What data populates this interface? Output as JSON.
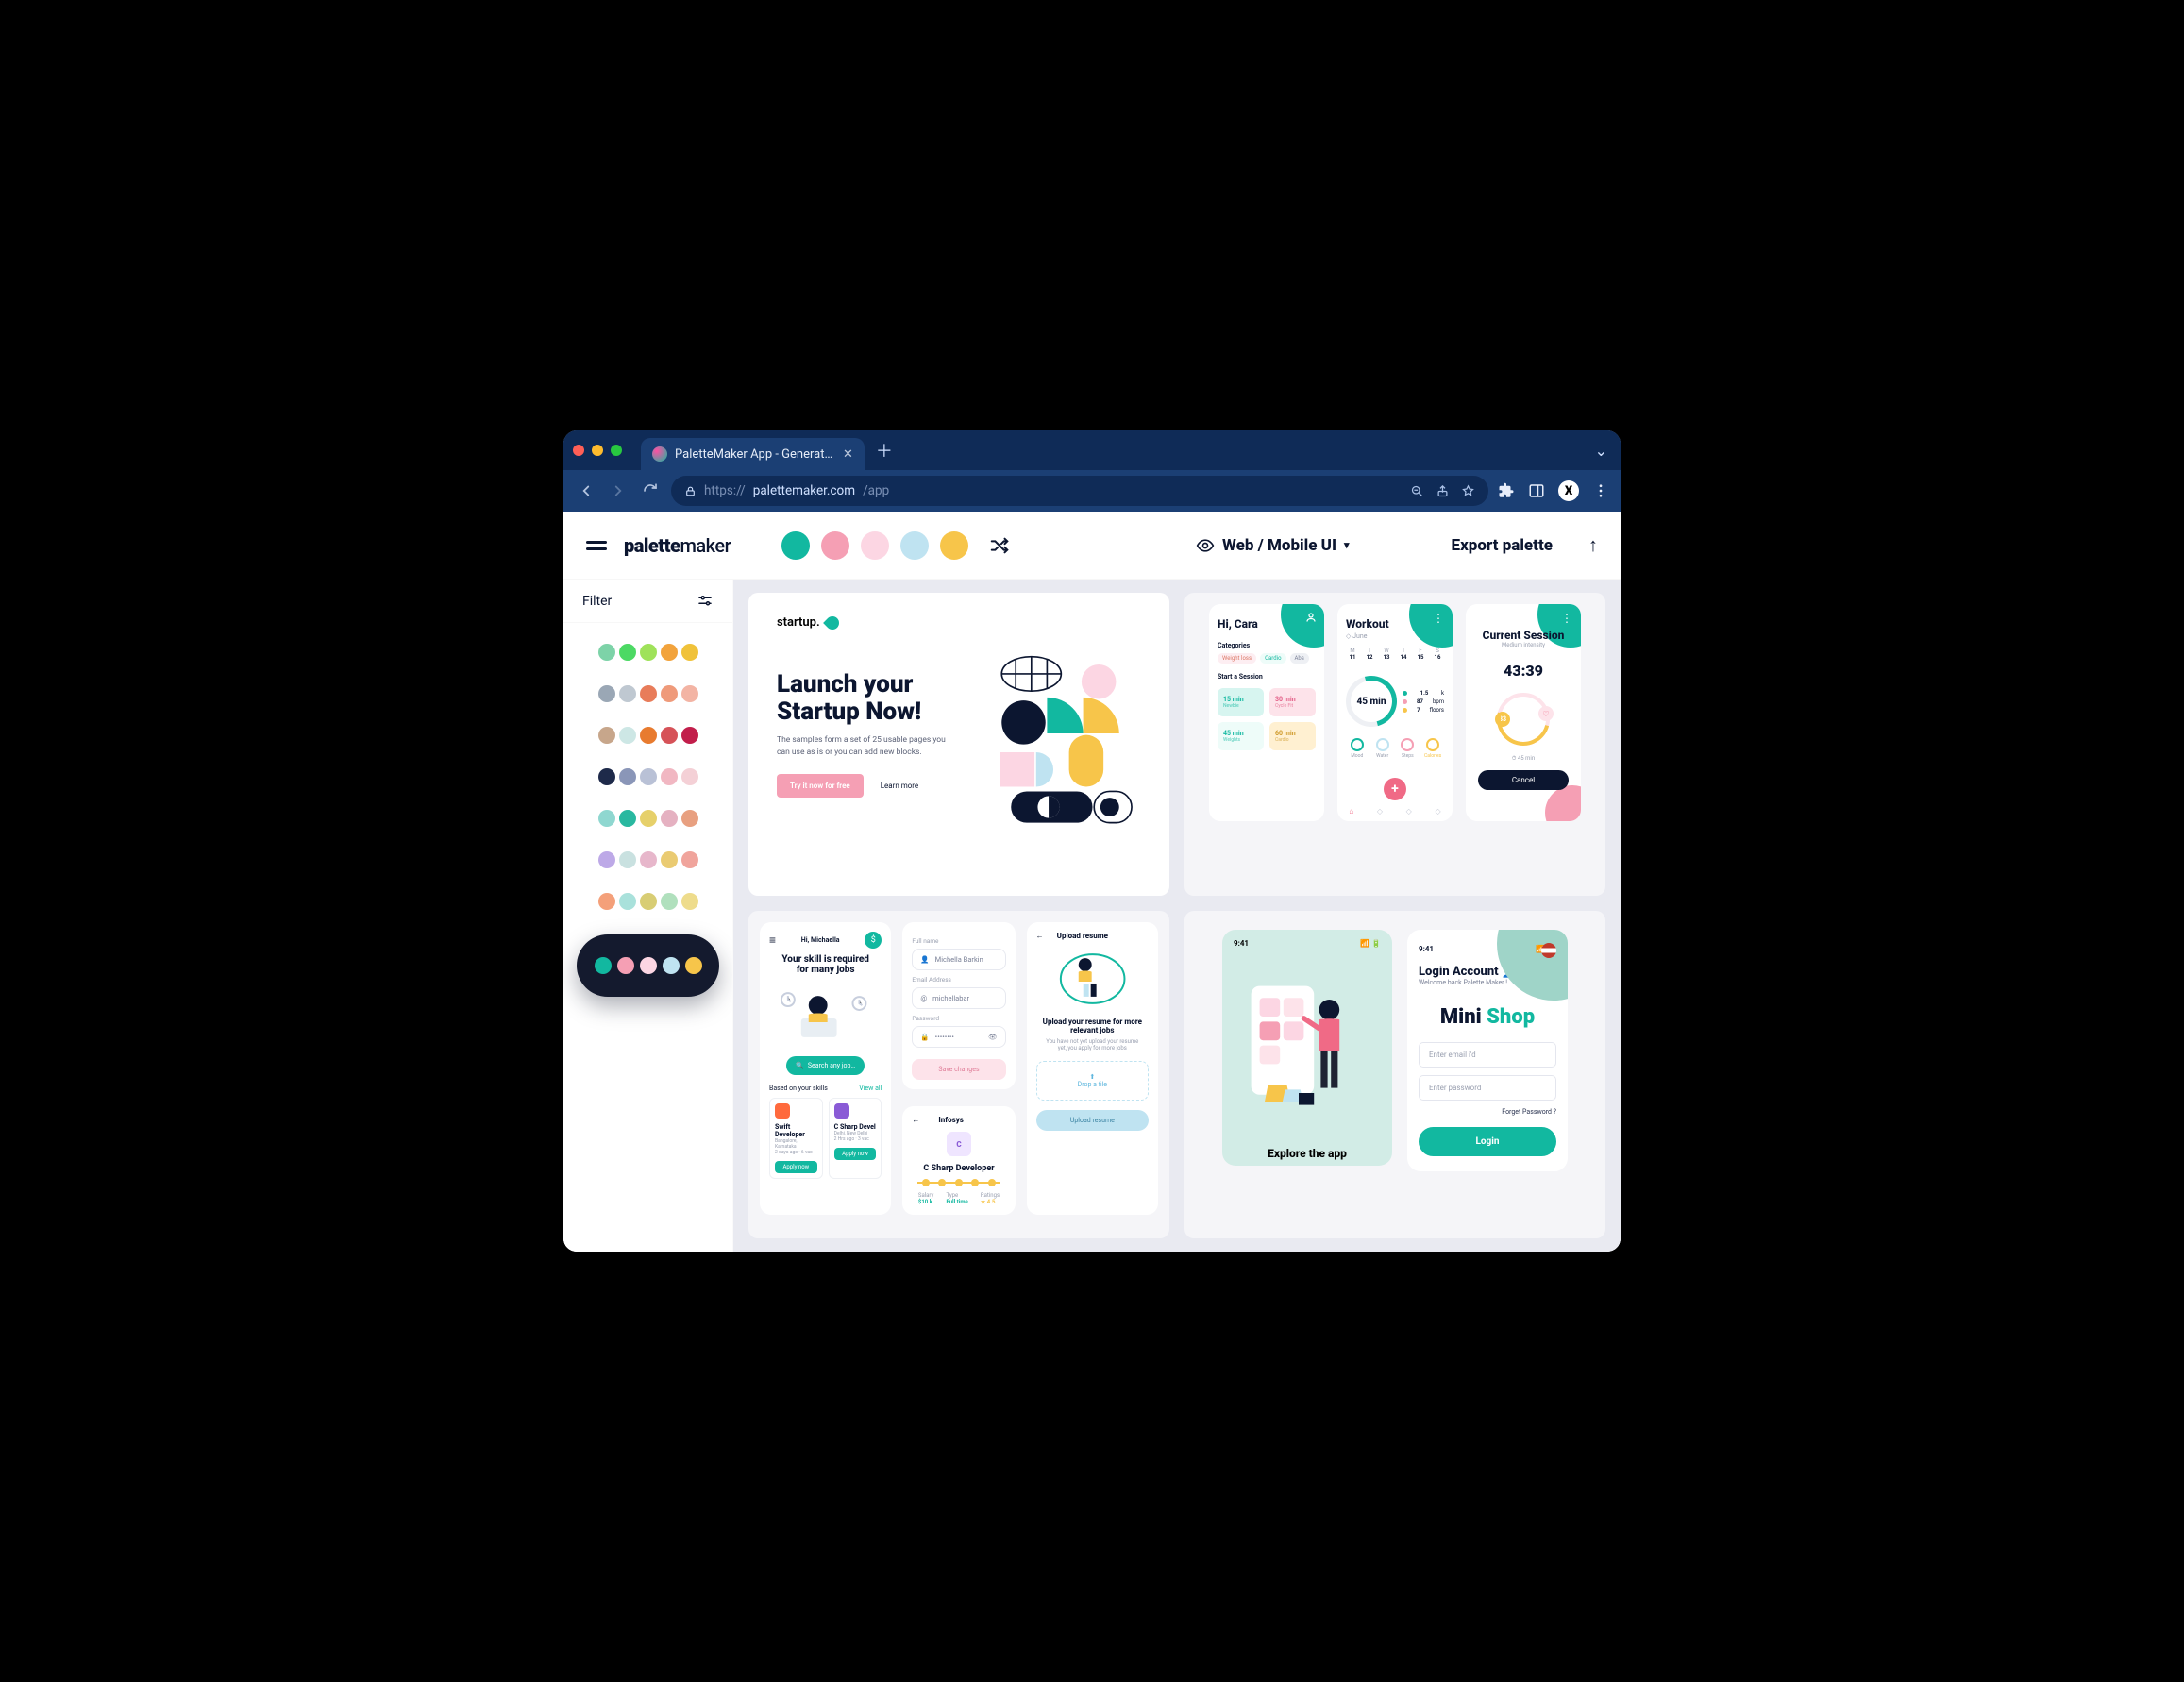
{
  "browser": {
    "tab_title": "PaletteMaker App - Generate C",
    "url_scheme": "https://",
    "url_host": "palettemaker.com",
    "url_path": "/app"
  },
  "header": {
    "logo_a": "palette",
    "logo_b": "maker",
    "palette": [
      "#12b8a0",
      "#f59fb4",
      "#fcd6e3",
      "#bfe3f1",
      "#f7c54a"
    ],
    "category_label": "Web / Mobile UI",
    "export_label": "Export palette"
  },
  "sidebar": {
    "filter_label": "Filter",
    "palettes": [
      [
        "#7dd3a8",
        "#4cd964",
        "#9fe25a",
        "#f2a33c",
        "#f0c23a"
      ],
      [
        "#9aa7b5",
        "#bfc8d1",
        "#e87c5a",
        "#ef9a7a",
        "#f3b4a4"
      ],
      [
        "#c7a68b",
        "#cde7e5",
        "#e87b2f",
        "#d65258",
        "#c21e4b"
      ],
      [
        "#1e2a4a",
        "#8a96b8",
        "#b9c1d6",
        "#f1b7c2",
        "#f4d0d6"
      ],
      [
        "#8fd7d0",
        "#29b8a0",
        "#e6d06a",
        "#e5b1c1",
        "#e8a080"
      ],
      [
        "#bda9e7",
        "#c9e1e0",
        "#e7b7cb",
        "#eacb72",
        "#f0a49c"
      ],
      [
        "#f4a07a",
        "#a9e1db",
        "#d8cd74",
        "#b0e0bd",
        "#eedc8c"
      ]
    ],
    "active_palette": [
      "#12b8a0",
      "#f59fb4",
      "#fcd6e3",
      "#bfe3f1",
      "#f7c54a"
    ]
  },
  "startup": {
    "brand": "startup.",
    "title_l1": "Launch your",
    "title_l2": "Startup Now!",
    "sub": "The samples form a set of 25 usable pages you can use as is or you can add new blocks.",
    "cta": "Try it now for free",
    "learn": "Learn more"
  },
  "workout": {
    "p1": {
      "greet": "Hi, Cara",
      "cat_label": "Categories",
      "pill1": "Weight loss",
      "pill2": "Cardio",
      "pill3": "Abs",
      "start_label": "Start a Session",
      "t1": "15 min",
      "t1s": "Newbie",
      "t2": "30 min",
      "t2s": "Cycle Fit",
      "t3": "45 min",
      "t3s": "Weights",
      "t4": "60 min",
      "t4s": "Cardio"
    },
    "p2": {
      "title": "Workout",
      "month": "June",
      "ring": "45 min",
      "s1v": "1.5",
      "s1l": "k",
      "s2v": "87",
      "s2l": "bpm",
      "s3v": "7",
      "s3l": "floors",
      "b1": "Mood",
      "b2": "Water",
      "b3": "Steps",
      "b4": "Calories",
      "days": [
        "M 11",
        "T 12",
        "W 13",
        "T 14",
        "F 15",
        "S 16"
      ]
    },
    "p3": {
      "title": "Current Session",
      "sub": "Medium intensity",
      "time": "43:39",
      "knob": "33",
      "left": "45 min",
      "cancel": "Cancel"
    }
  },
  "jobs": {
    "p1": {
      "hi": "Hi, Michaella",
      "headline": "Your skill is required for many jobs",
      "search": "Search any job…",
      "based": "Based on your skills",
      "viewall": "View all",
      "c1_title": "Swift Developer",
      "c1_sub": "Bangalore, Karnataka",
      "c1_meta": "2 days ago · 6 vac",
      "c2_title": "C Sharp Devel",
      "c2_sub": "Delhi, New Delhi",
      "c2_meta": "2 Hrs ago · 3 vac",
      "apply": "Apply now"
    },
    "p2": {
      "l1": "Full name",
      "v1": "Michella Barkin",
      "l2": "Email Address",
      "v2": "michellabar",
      "l3": "Password",
      "v3": "••••••••",
      "save": "Save changes",
      "company": "Infosys",
      "role": "C Sharp Developer",
      "st1": "Salary",
      "sv1": "$10 k",
      "st2": "Type",
      "sv2": "Full time",
      "st3": "Ratings",
      "sv3": "★ 4.5"
    },
    "p3": {
      "title": "Upload resume",
      "desc": "Upload your resume for more relevant jobs",
      "note": "You have not yet upload your resume yet, you apply for more jobs",
      "drop": "Drop a file",
      "btn": "Upload resume"
    }
  },
  "shop": {
    "time": "9:41",
    "explore": "Explore the app",
    "title": "Login Account",
    "sub": "Welcome back Palette Maker !",
    "logo_a": "Mini ",
    "logo_b": "Shop",
    "email_ph": "Enter email i'd",
    "pass_ph": "Enter password",
    "forgot": "Forget Password ?",
    "login": "Login"
  }
}
